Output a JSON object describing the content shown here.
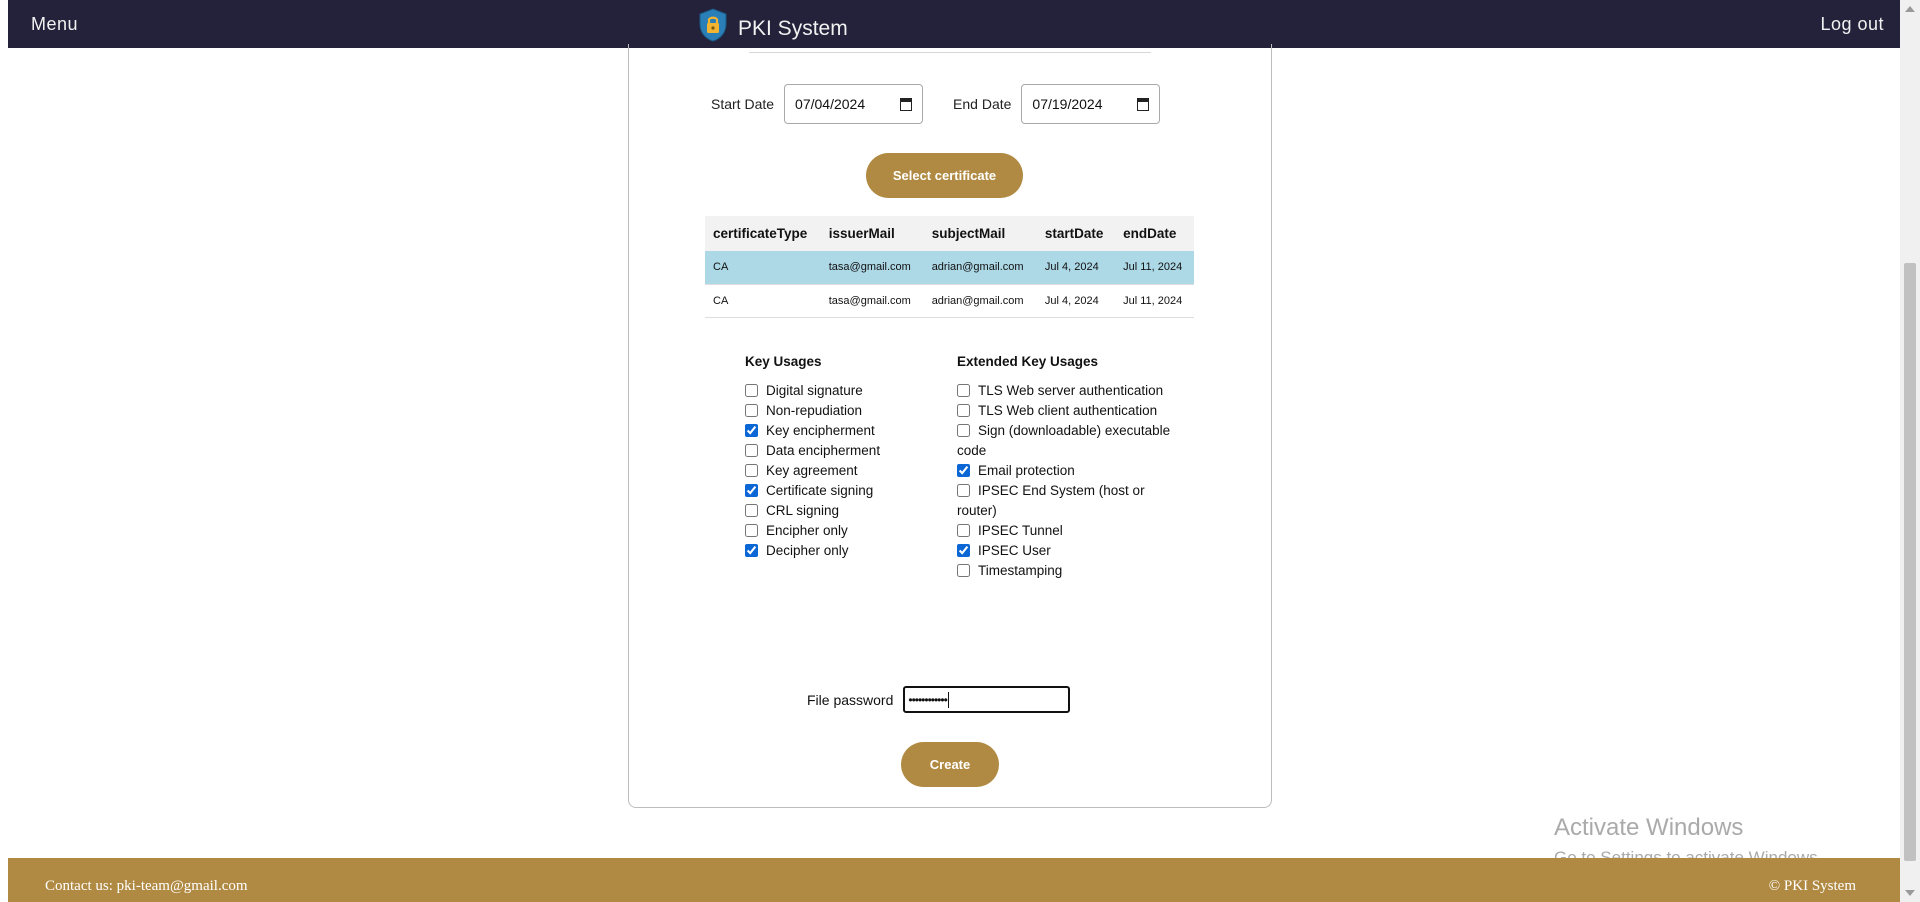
{
  "navbar": {
    "menu_label": "Menu",
    "title": "PKI System",
    "logout_label": "Log out"
  },
  "form": {
    "start_date_label": "Start Date",
    "start_date_value": "07/04/2024",
    "end_date_label": "End Date",
    "end_date_value": "07/19/2024",
    "select_button": "Select certificate",
    "password_label": "File password",
    "password_mask": "••••••••••••",
    "create_button": "Create"
  },
  "table": {
    "columns": [
      "certificateType",
      "issuerMail",
      "subjectMail",
      "startDate",
      "endDate"
    ],
    "rows": [
      [
        "CA",
        "tasa@gmail.com",
        "adrian@gmail.com",
        "Jul 4, 2024",
        "Jul 11, 2024"
      ],
      [
        "CA",
        "tasa@gmail.com",
        "adrian@gmail.com",
        "Jul 4, 2024",
        "Jul 11, 2024"
      ]
    ],
    "selected_row": 0
  },
  "key_usages": {
    "heading": "Key Usages",
    "items": [
      {
        "label": "Digital signature",
        "checked": false
      },
      {
        "label": "Non-repudiation",
        "checked": false
      },
      {
        "label": "Key encipherment",
        "checked": true
      },
      {
        "label": "Data encipherment",
        "checked": false
      },
      {
        "label": "Key agreement",
        "checked": false
      },
      {
        "label": "Certificate signing",
        "checked": true
      },
      {
        "label": "CRL signing",
        "checked": false
      },
      {
        "label": "Encipher only",
        "checked": false
      },
      {
        "label": "Decipher only",
        "checked": true
      }
    ]
  },
  "extended_key_usages": {
    "heading": "Extended Key Usages",
    "items": [
      {
        "label": "TLS Web server authentication",
        "checked": false
      },
      {
        "label": "TLS Web client authentication",
        "checked": false
      },
      {
        "label": "Sign (downloadable) executable code",
        "checked": false
      },
      {
        "label": "Email protection",
        "checked": true
      },
      {
        "label": "IPSEC End System (host or router)",
        "checked": false
      },
      {
        "label": "IPSEC Tunnel",
        "checked": false
      },
      {
        "label": "IPSEC User",
        "checked": true
      },
      {
        "label": "Timestamping",
        "checked": false
      }
    ]
  },
  "watermark": {
    "line1": "Activate Windows",
    "line2": "Go to Settings to activate Windows."
  },
  "footer": {
    "contact": "Contact us: pki-team@gmail.com",
    "copyright": "© PKI System"
  },
  "colors": {
    "navbar": "#23223a",
    "accent_gold": "#b08a42",
    "selected_row": "#add8e6"
  }
}
